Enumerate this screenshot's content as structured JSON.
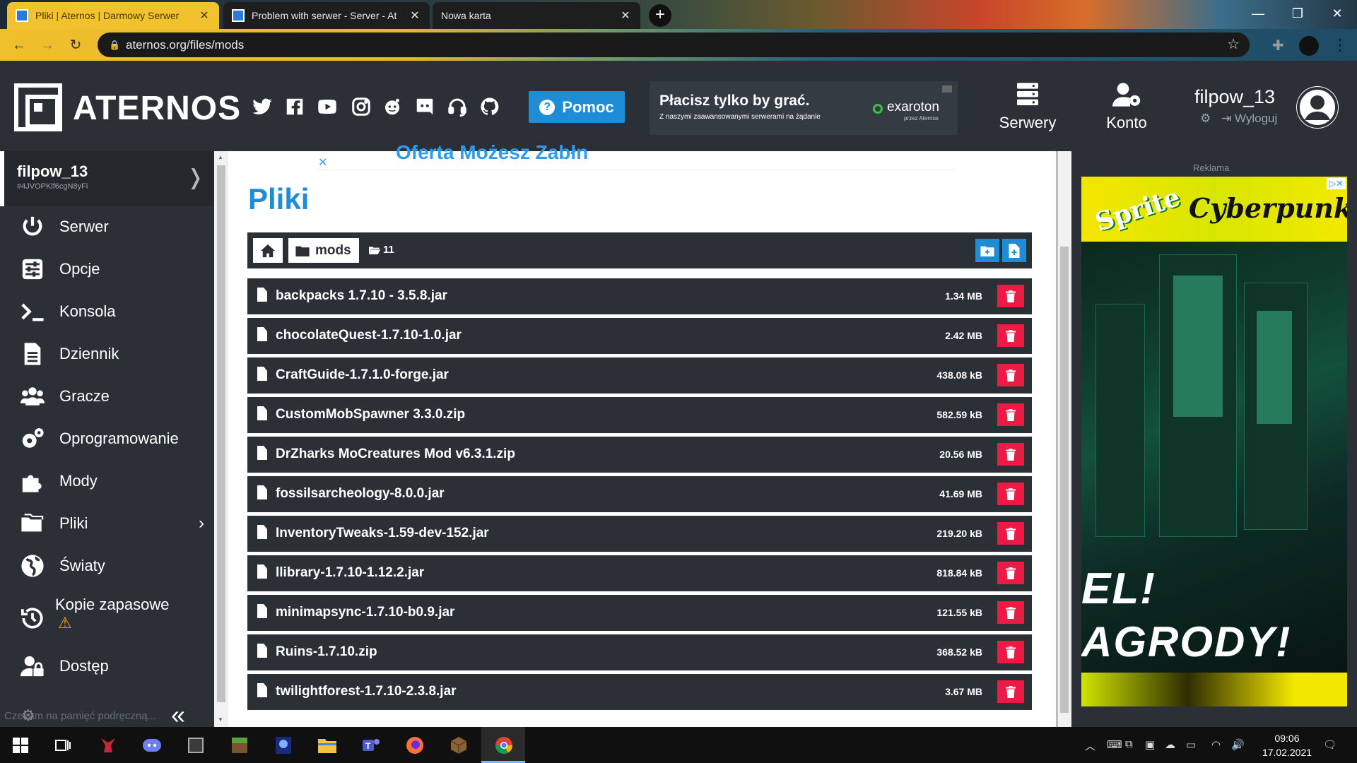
{
  "browser": {
    "tabs": [
      {
        "title": "Pliki | Aternos | Darmowy Serwer",
        "active": true
      },
      {
        "title": "Problem with serwer - Server - At",
        "active": false
      },
      {
        "title": "Nowa karta",
        "active": false
      }
    ],
    "url": "aternos.org/files/mods"
  },
  "header": {
    "logo": "ATERNOS",
    "help_label": "Pomoc",
    "ad_title": "Płacisz tylko by grać.",
    "ad_subtitle": "Z naszymi zaawansowanymi serwerami na żądanie",
    "ad_brand": "exaroton",
    "ad_brand_sub": "przez Aternos",
    "nav": [
      {
        "label": "Serwery",
        "icon": "servers-icon"
      },
      {
        "label": "Konto",
        "icon": "account-settings-icon"
      }
    ],
    "username": "filpow_13",
    "logout_label": "Wyloguj"
  },
  "sidebar": {
    "server_name": "filpow_13",
    "server_id": "#4JVOPKlf6cgN8yFi",
    "items": [
      {
        "label": "Serwer",
        "icon": "power-icon"
      },
      {
        "label": "Opcje",
        "icon": "sliders-icon"
      },
      {
        "label": "Konsola",
        "icon": "terminal-icon"
      },
      {
        "label": "Dziennik",
        "icon": "log-file-icon"
      },
      {
        "label": "Gracze",
        "icon": "players-icon"
      },
      {
        "label": "Oprogramowanie",
        "icon": "software-gears-icon"
      },
      {
        "label": "Mody",
        "icon": "puzzle-icon"
      },
      {
        "label": "Pliki",
        "icon": "folders-icon"
      },
      {
        "label": "Światy",
        "icon": "globe-icon"
      },
      {
        "label": "Kopie zapasowe",
        "icon": "backup-history-icon"
      },
      {
        "label": "Dostęp",
        "icon": "access-lock-icon"
      }
    ],
    "footer_text": "Czekam na pamięć podręczną..."
  },
  "main": {
    "ad_strip_text": "Oferta Możesz Zabłn",
    "title": "Pliki",
    "breadcrumb": {
      "folder": "mods",
      "count": "11"
    },
    "files": [
      {
        "name": "backpacks 1.7.10 - 3.5.8.jar",
        "size": "1.34 MB"
      },
      {
        "name": "chocolateQuest-1.7.10-1.0.jar",
        "size": "2.42 MB"
      },
      {
        "name": "CraftGuide-1.7.1.0-forge.jar",
        "size": "438.08 kB"
      },
      {
        "name": "CustomMobSpawner 3.3.0.zip",
        "size": "582.59 kB"
      },
      {
        "name": "DrZharks MoCreatures Mod v6.3.1.zip",
        "size": "20.56 MB"
      },
      {
        "name": "fossilsarcheology-8.0.0.jar",
        "size": "41.69 MB"
      },
      {
        "name": "InventoryTweaks-1.59-dev-152.jar",
        "size": "219.20 kB"
      },
      {
        "name": "llibrary-1.7.10-1.12.2.jar",
        "size": "818.84 kB"
      },
      {
        "name": "minimapsync-1.7.10-b0.9.jar",
        "size": "121.55 kB"
      },
      {
        "name": "Ruins-1.7.10.zip",
        "size": "368.52 kB"
      },
      {
        "name": "twilightforest-1.7.10-2.3.8.jar",
        "size": "3.67 MB"
      }
    ]
  },
  "right_ad": {
    "label": "Reklama",
    "brand1": "Sprite",
    "brand2": "Cyberpunk",
    "line1": "EL!",
    "line2": "AGRODY!"
  },
  "taskbar": {
    "time": "09:06",
    "date": "17.02.2021"
  },
  "colors": {
    "accent": "#1f8cd8",
    "delete": "#ec1b46",
    "panel": "#2b3036"
  }
}
